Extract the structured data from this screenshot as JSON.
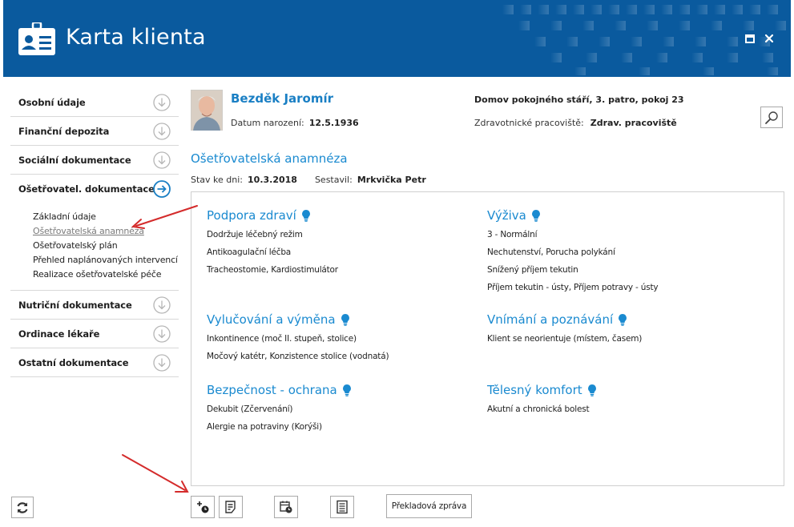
{
  "window": {
    "title": "Karta klienta",
    "icons": {
      "app": "id-card-icon",
      "maximize": "maximize-icon",
      "close": "close-icon"
    },
    "header_color": "#0a5a9e"
  },
  "sidebar": {
    "items": [
      {
        "label": "Osobní údaje",
        "icon": "arrow-down-circle-icon"
      },
      {
        "label": "Finanční depozita",
        "icon": "arrow-down-circle-icon"
      },
      {
        "label": "Sociální dokumentace",
        "icon": "arrow-down-circle-icon"
      },
      {
        "label": "Ošetřovatel. dokumentace",
        "icon": "arrow-right-circle-icon",
        "expanded": true
      }
    ],
    "sub_items": [
      {
        "label": "Základní údaje"
      },
      {
        "label": "Ošetřovatelská anamnéza",
        "active": true
      },
      {
        "label": "Ošetřovatelský plán"
      },
      {
        "label": "Přehled naplánovaných intervencí"
      },
      {
        "label": "Realizace ošetřovatelské péče"
      }
    ],
    "items_after": [
      {
        "label": "Nutriční dokumentace",
        "icon": "arrow-down-circle-icon"
      },
      {
        "label": "Ordinace lékaře",
        "icon": "arrow-down-circle-icon"
      },
      {
        "label": "Ostatní dokumentace",
        "icon": "arrow-down-circle-icon"
      }
    ],
    "refresh_icon": "refresh-icon"
  },
  "patient": {
    "name": "Bezděk Jaromír",
    "dob_label": "Datum narození:",
    "dob": "12.5.1936",
    "home": "Domov pokojného stáří, 3. patro, pokoj 23",
    "workplace_label": "Zdravotnické pracoviště:",
    "workplace": "Zdrav. pracoviště",
    "search_icon": "magnifier-icon"
  },
  "section": {
    "title": "Ošetřovatelská anamnéza",
    "date_label": "Stav ke dni:",
    "date": "10.3.2018",
    "author_label": "Sestavil:",
    "author": "Mrkvička Petr"
  },
  "categories": {
    "left": [
      {
        "title": "Podpora zdraví",
        "items": [
          "Dodržuje léčebný režim",
          "Antikoagulační léčba",
          "Tracheostomie, Kardiostimulátor"
        ]
      },
      {
        "title": "Vylučování a výměna",
        "items": [
          "Inkontinence (moč II. stupeň, stolice)",
          "Močový katétr, Konzistence stolice (vodnatá)"
        ]
      },
      {
        "title": "Bezpečnost - ochrana",
        "items": [
          "Dekubit (Zčervenání)",
          "Alergie na potraviny (Korýši)"
        ]
      }
    ],
    "right": [
      {
        "title": "Výživa",
        "items": [
          "3 - Normální",
          "Nechutenství, Porucha polykání",
          "Snížený příjem tekutin",
          "Příjem tekutin - ústy, Příjem potravy - ústy"
        ]
      },
      {
        "title": "Vnímání a poznávání",
        "items": [
          "Klient se neorientuje (místem, časem)"
        ]
      },
      {
        "title": "Tělesný komfort",
        "items": [
          "Akutní a chronická bolest"
        ]
      }
    ],
    "accent": "#1a8ad0",
    "hint_icon": "lightbulb-icon"
  },
  "toolbar": {
    "buttons": [
      "add-record-icon",
      "notes-icon",
      "calendar-clock-icon",
      "document-list-icon"
    ],
    "text_button": "Překladová zpráva"
  }
}
